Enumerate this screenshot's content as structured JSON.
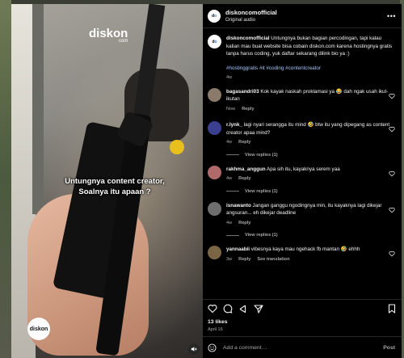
{
  "video": {
    "watermark_top": "diskon",
    "watermark_top_sub": "com",
    "caption_line1": "Untungnya content creator,",
    "caption_line2": "Soalnya itu apaan ?",
    "watermark_bottom": "diskon"
  },
  "header": {
    "username": "diskoncomofficial",
    "audio": "Original audio",
    "more": "•••"
  },
  "caption": {
    "username": "diskoncomofficial",
    "text": "Untungnya bukan bagian percodingan, tapi kalau kalian mau buat website bisa cobain diskon.com karena hostingnya gratis tanpa harus coding, yuk daftar sekarang dilink bio ya :)",
    "tags": "#hostinggratis #it #coding #contentcreator",
    "time": "4w"
  },
  "comments": [
    {
      "username": "bagasandri03",
      "text": "Kok kayak naskah proklamasi ya 😂 dah ngak usah ikut-ikutan",
      "time": "Now",
      "reply": "Reply",
      "view_replies": "",
      "avatar_color": "#8a7a6a"
    },
    {
      "username": "r.lynk_",
      "text": "lagi nyari serangga itu mind 🤣 btw itu yang dipegang as content creator apaa mind?",
      "time": "4w",
      "reply": "Reply",
      "view_replies": "View replies (1)",
      "avatar_color": "#3b3f8f"
    },
    {
      "username": "rakhma_anggun",
      "text": "Apa sih itu, kayaknya serem yaa",
      "time": "4w",
      "reply": "Reply",
      "view_replies": "View replies (1)",
      "avatar_color": "#b06a6a"
    },
    {
      "username": "isnawanto",
      "text": "Jangan ganggu ngodingnya min, itu kayaknya lagi dikejar angsuran... eh dikejar deadline",
      "time": "4w",
      "reply": "Reply",
      "view_replies": "View replies (1)",
      "avatar_color": "#6e6e6e"
    },
    {
      "username": "yannaabii",
      "text": "vibesnya kaya mau ngehack fb mantan 🤣 ehhh",
      "time": "3w",
      "reply": "Reply",
      "view_replies": "",
      "see_translation": "See translation",
      "avatar_color": "#7a6545"
    }
  ],
  "footer": {
    "likes": "13 likes",
    "date": "April 16",
    "add_comment_placeholder": "Add a comment…",
    "post_label": "Post"
  },
  "icons": {
    "like": "heart-icon",
    "comment": "comment-icon",
    "share": "share-icon",
    "send": "send-icon",
    "save": "bookmark-icon",
    "emoji": "emoji-icon",
    "mute": "speaker-muted-icon"
  }
}
